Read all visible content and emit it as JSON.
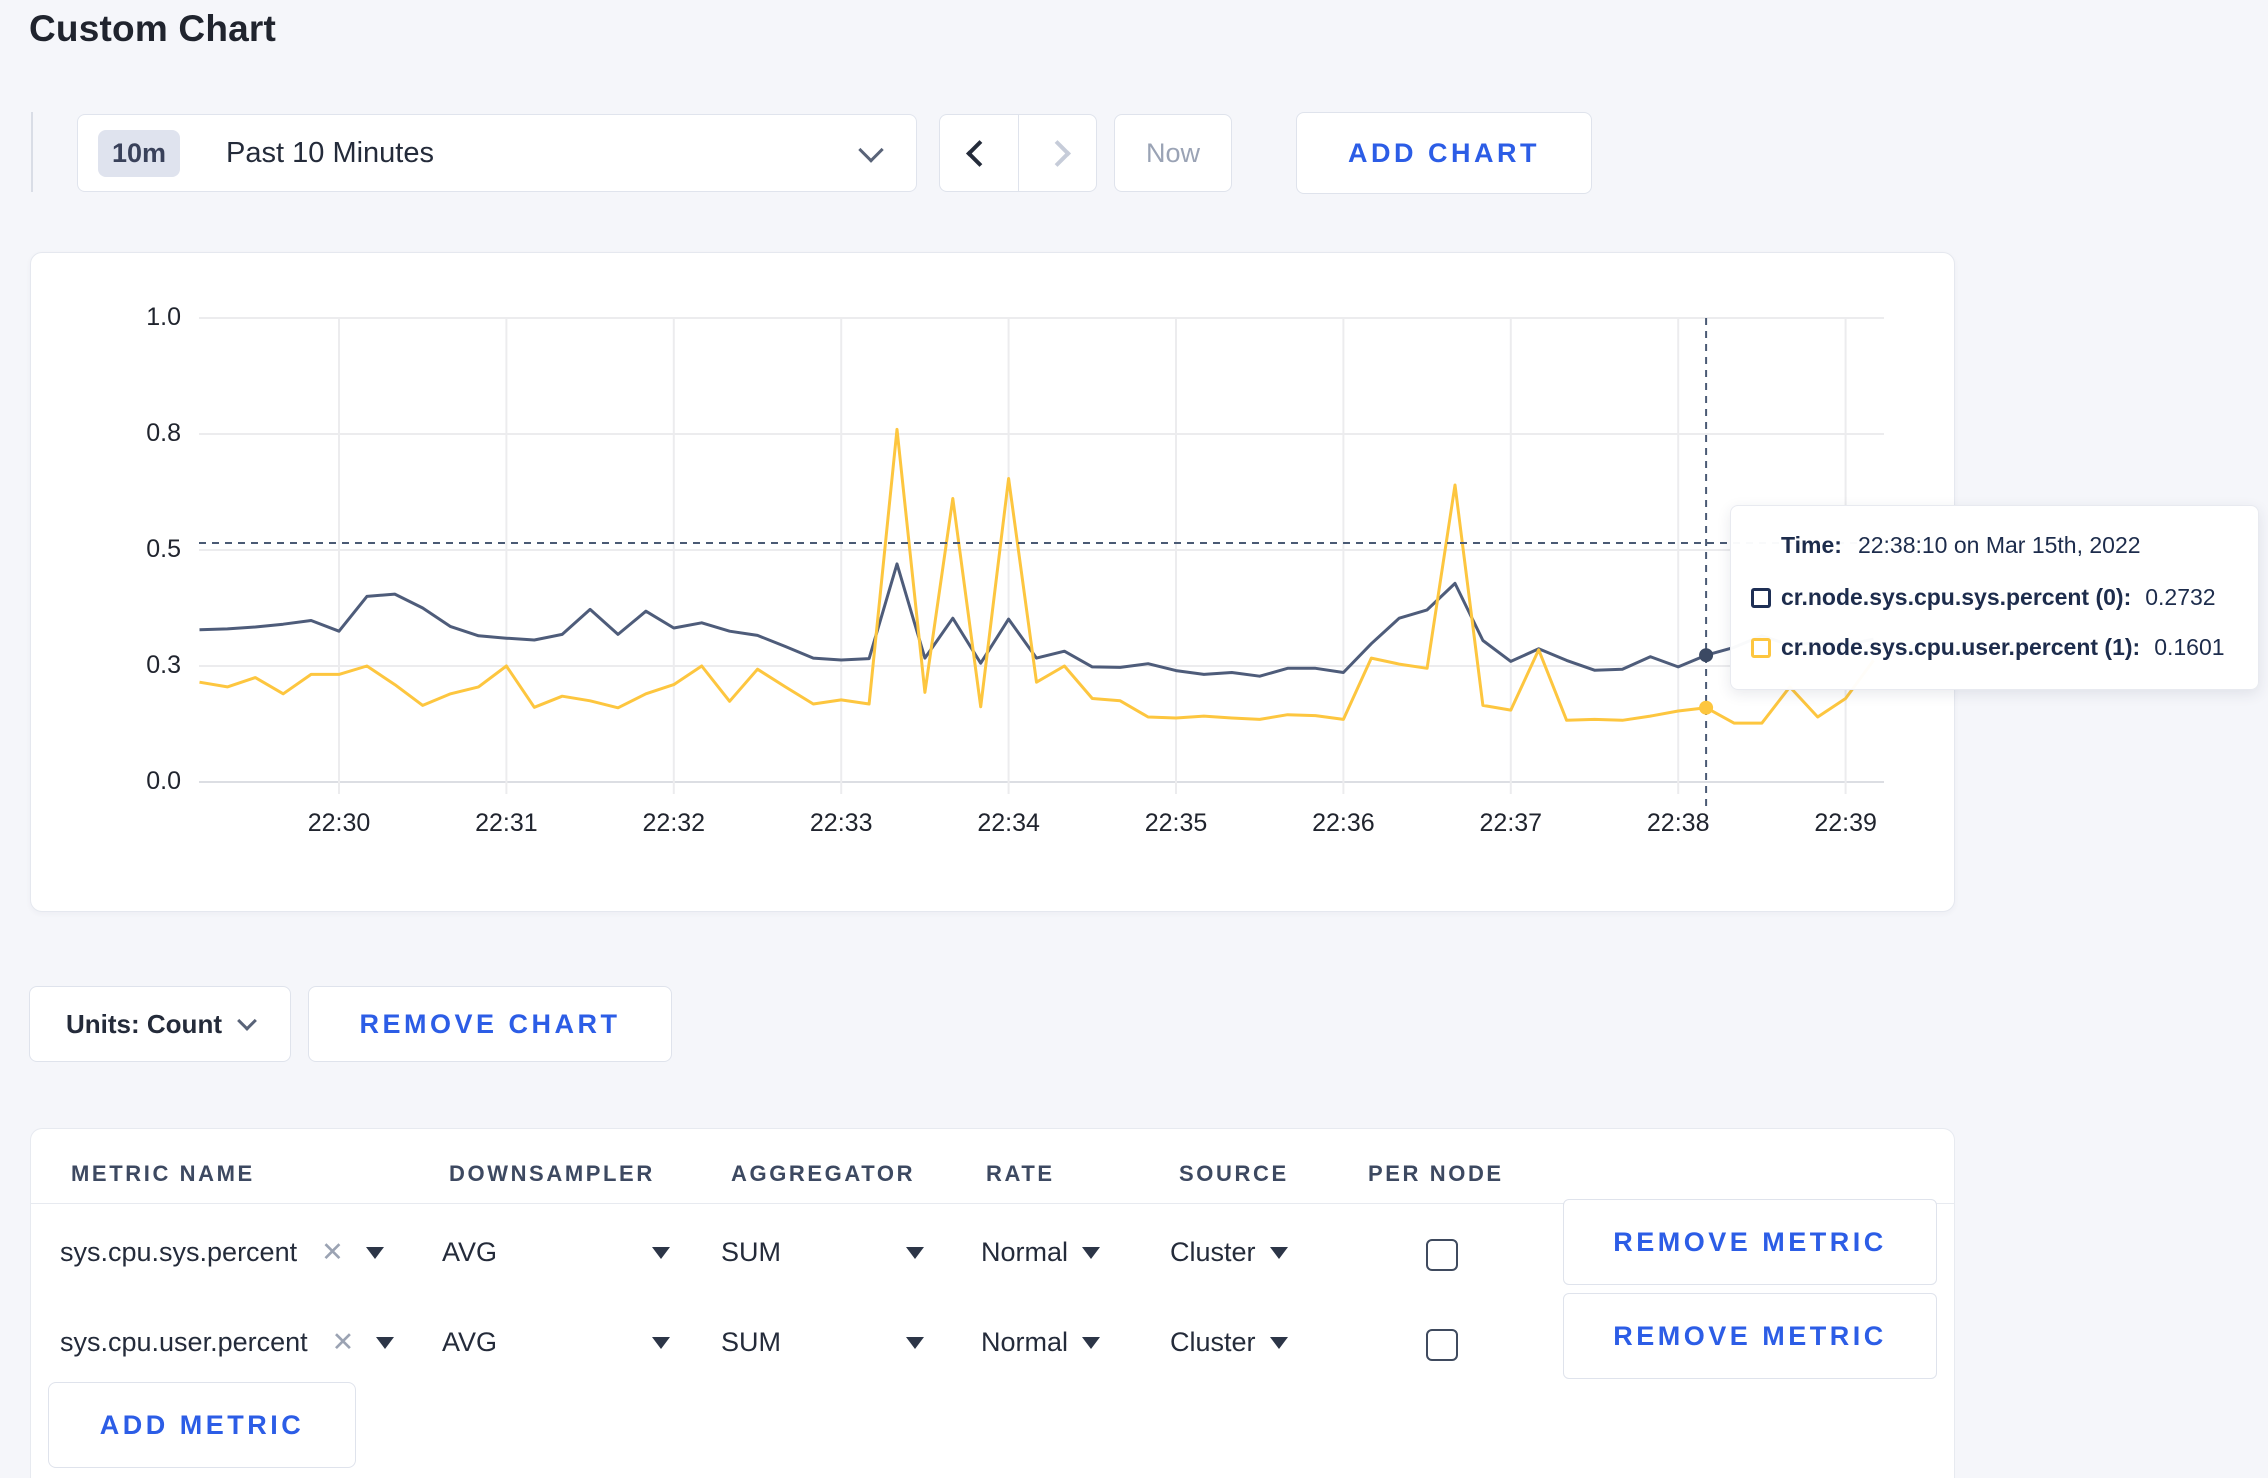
{
  "page": {
    "title": "Custom Chart"
  },
  "toolbar": {
    "range_badge": "10m",
    "range_label": "Past 10 Minutes",
    "prev_icon": "chevron-left",
    "next_icon": "chevron-right",
    "now_label": "Now",
    "add_chart_label": "ADD CHART"
  },
  "chart_controls": {
    "units_label": "Units: Count",
    "remove_chart_label": "REMOVE CHART"
  },
  "tooltip": {
    "time_label": "Time:",
    "time_value": "22:38:10 on Mar 15th, 2022",
    "series": [
      {
        "name": "cr.node.sys.cpu.sys.percent (0):",
        "value": "0.2732",
        "color": "#1e2f55"
      },
      {
        "name": "cr.node.sys.cpu.user.percent (1):",
        "value": "0.1601",
        "color": "#fdc63f"
      }
    ]
  },
  "chart_data": {
    "type": "line",
    "title": "",
    "x_start": "22:29:10",
    "x_step_sec": 10,
    "x_count": 61,
    "tick_indices": [
      5,
      11,
      17,
      23,
      29,
      35,
      41,
      47,
      53,
      59
    ],
    "tick_labels": [
      "22:30",
      "22:31",
      "22:32",
      "22:33",
      "22:34",
      "22:35",
      "22:36",
      "22:37",
      "22:38",
      "22:39"
    ],
    "ylim": [
      0,
      1
    ],
    "y_ticks": [
      {
        "v": 0.0,
        "label": "0.0"
      },
      {
        "v": 0.25,
        "label": "0.3"
      },
      {
        "v": 0.5,
        "label": "0.5"
      },
      {
        "v": 0.75,
        "label": "0.8"
      },
      {
        "v": 1.0,
        "label": "1.0"
      }
    ],
    "grid": true,
    "legend_position": "tooltip",
    "series": [
      {
        "name": "cr.node.sys.cpu.sys.percent",
        "color": "#4e5c7a",
        "values": [
          0.328,
          0.33,
          0.334,
          0.34,
          0.348,
          0.325,
          0.4,
          0.405,
          0.375,
          0.335,
          0.315,
          0.31,
          0.306,
          0.318,
          0.372,
          0.318,
          0.368,
          0.332,
          0.343,
          0.325,
          0.316,
          0.292,
          0.267,
          0.263,
          0.266,
          0.47,
          0.267,
          0.353,
          0.256,
          0.351,
          0.267,
          0.282,
          0.248,
          0.247,
          0.255,
          0.24,
          0.232,
          0.236,
          0.228,
          0.245,
          0.245,
          0.236,
          0.298,
          0.353,
          0.371,
          0.428,
          0.305,
          0.26,
          0.287,
          0.262,
          0.241,
          0.243,
          0.27,
          0.248,
          0.2732,
          0.29,
          0.315,
          0.295,
          0.3,
          0.295,
          0.308
        ]
      },
      {
        "name": "cr.node.sys.cpu.user.percent",
        "color": "#fdc63f",
        "values": [
          0.215,
          0.205,
          0.225,
          0.19,
          0.232,
          0.232,
          0.25,
          0.21,
          0.165,
          0.19,
          0.205,
          0.25,
          0.161,
          0.185,
          0.175,
          0.16,
          0.19,
          0.21,
          0.25,
          0.174,
          0.243,
          0.205,
          0.168,
          0.177,
          0.168,
          0.76,
          0.193,
          0.611,
          0.162,
          0.654,
          0.215,
          0.25,
          0.18,
          0.175,
          0.14,
          0.138,
          0.142,
          0.138,
          0.135,
          0.145,
          0.143,
          0.135,
          0.267,
          0.254,
          0.245,
          0.64,
          0.165,
          0.155,
          0.285,
          0.133,
          0.135,
          0.133,
          0.142,
          0.153,
          0.1601,
          0.127,
          0.127,
          0.205,
          0.14,
          0.18,
          0.262
        ]
      }
    ],
    "crosshair": {
      "index": 54,
      "time": "22:38:10",
      "hline_value": 0.515,
      "highlight_values": [
        0.2732,
        0.1601
      ]
    }
  },
  "metrics_table": {
    "headers": [
      "METRIC NAME",
      "DOWNSAMPLER",
      "AGGREGATOR",
      "RATE",
      "SOURCE",
      "PER NODE"
    ],
    "rows": [
      {
        "metric_name": "sys.cpu.sys.percent",
        "downsampler": "AVG",
        "aggregator": "SUM",
        "rate": "Normal",
        "source": "Cluster",
        "per_node_checked": false,
        "remove_label": "REMOVE METRIC"
      },
      {
        "metric_name": "sys.cpu.user.percent",
        "downsampler": "AVG",
        "aggregator": "SUM",
        "rate": "Normal",
        "source": "Cluster",
        "per_node_checked": false,
        "remove_label": "REMOVE METRIC"
      }
    ],
    "add_metric_label": "ADD METRIC",
    "close_icon": "x"
  }
}
